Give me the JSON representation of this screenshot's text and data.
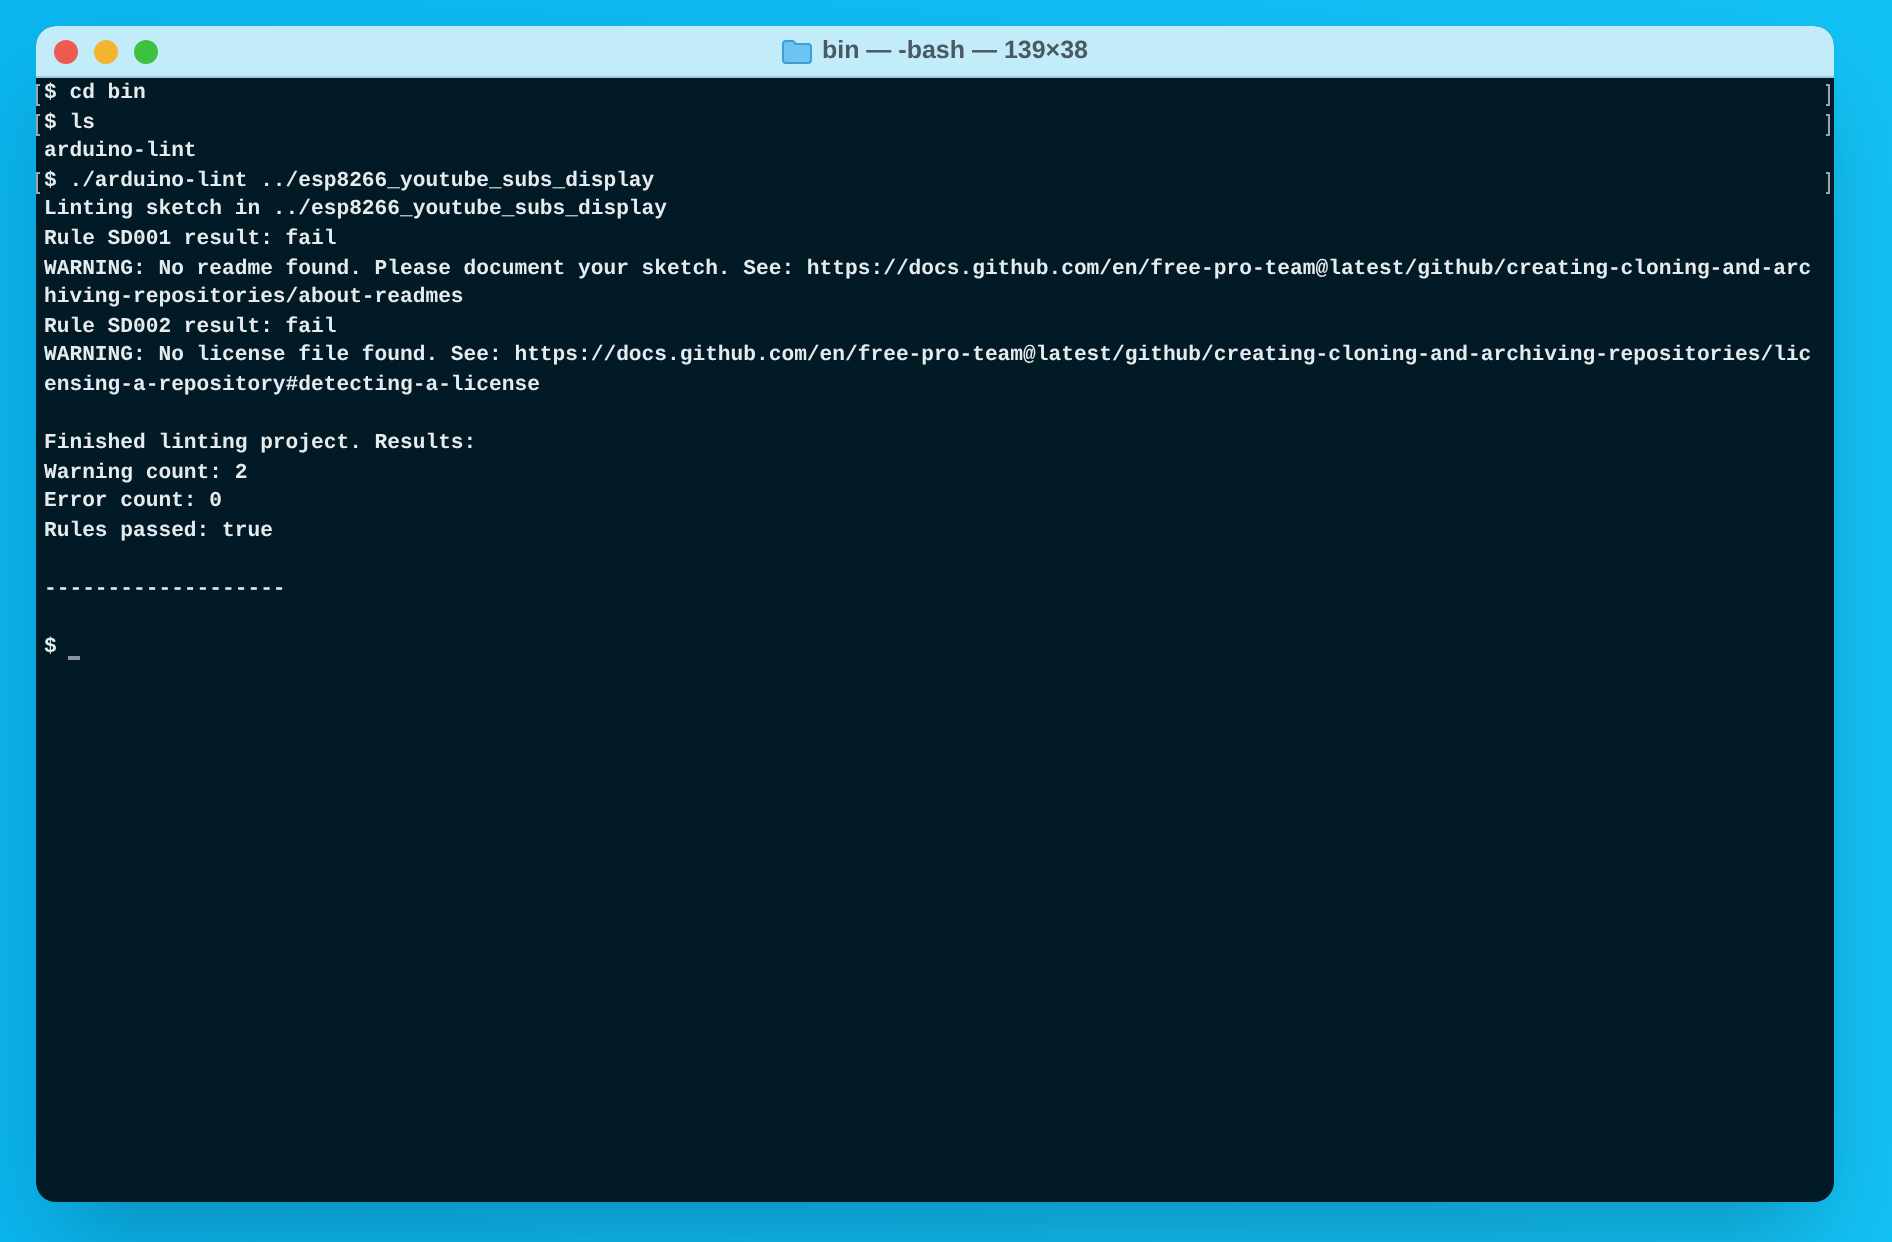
{
  "window": {
    "title": "bin — -bash — 139×38"
  },
  "terminal": {
    "lines": [
      {
        "kind": "text",
        "text": "$ cd bin",
        "marked": true
      },
      {
        "kind": "text",
        "text": "$ ls",
        "marked": true
      },
      {
        "kind": "text",
        "text": "arduino-lint",
        "marked": false
      },
      {
        "kind": "text",
        "text": "$ ./arduino-lint ../esp8266_youtube_subs_display",
        "marked": true
      },
      {
        "kind": "text",
        "text": "Linting sketch in ../esp8266_youtube_subs_display",
        "marked": false
      },
      {
        "kind": "text",
        "text": "Rule SD001 result: fail",
        "marked": false
      },
      {
        "kind": "text",
        "text": "WARNING: No readme found. Please document your sketch. See: https://docs.github.com/en/free-pro-team@latest/github/creating-cloning-and-arc",
        "marked": false
      },
      {
        "kind": "text",
        "text": "hiving-repositories/about-readmes",
        "marked": false
      },
      {
        "kind": "text",
        "text": "Rule SD002 result: fail",
        "marked": false
      },
      {
        "kind": "text",
        "text": "WARNING: No license file found. See: https://docs.github.com/en/free-pro-team@latest/github/creating-cloning-and-archiving-repositories/lic",
        "marked": false
      },
      {
        "kind": "text",
        "text": "ensing-a-repository#detecting-a-license",
        "marked": false
      },
      {
        "kind": "blank"
      },
      {
        "kind": "text",
        "text": "Finished linting project. Results:",
        "marked": false
      },
      {
        "kind": "text",
        "text": "Warning count: 2",
        "marked": false
      },
      {
        "kind": "text",
        "text": "Error count: 0",
        "marked": false
      },
      {
        "kind": "text",
        "text": "Rules passed: true",
        "marked": false
      },
      {
        "kind": "blank"
      },
      {
        "kind": "text",
        "text": "-------------------",
        "marked": false
      },
      {
        "kind": "blank"
      },
      {
        "kind": "prompt",
        "text": "$",
        "cursor": true
      }
    ]
  }
}
